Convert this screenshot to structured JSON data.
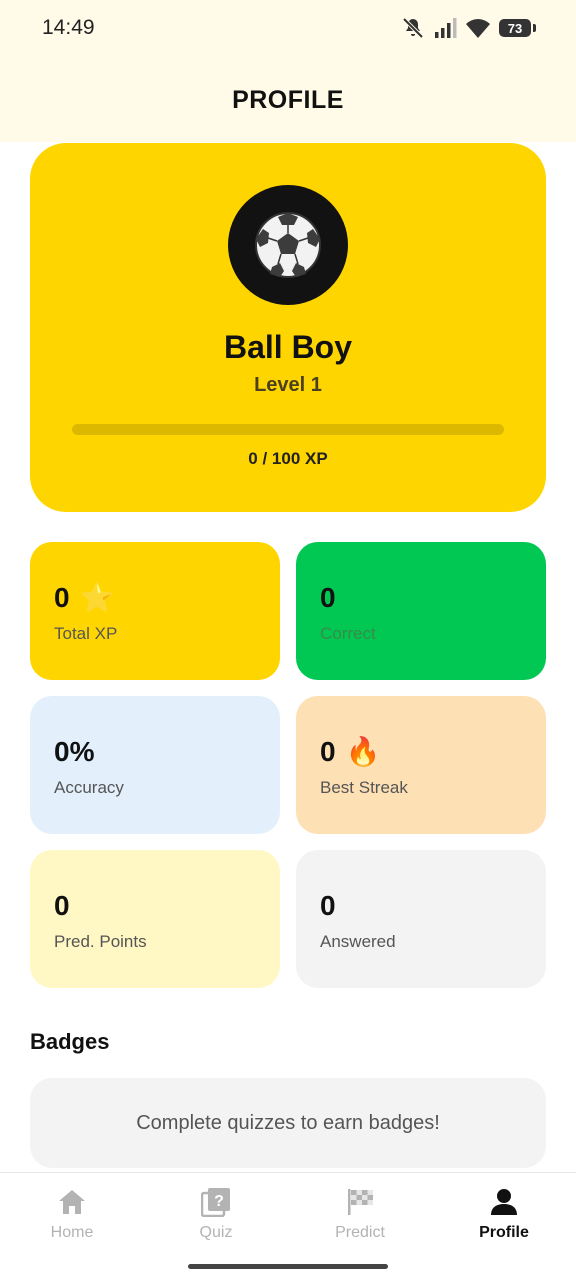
{
  "status_bar": {
    "time": "14:49",
    "battery": "73"
  },
  "header": {
    "title": "PROFILE"
  },
  "profile": {
    "avatar_icon": "soccer-ball-icon",
    "name": "Ball Boy",
    "level": "Level 1",
    "xp_text": "0 / 100 XP",
    "xp_progress": 0
  },
  "stats": [
    {
      "value": "0",
      "emoji": "⭐",
      "label": "Total XP",
      "bg": "#ffd500",
      "label_color": "#555"
    },
    {
      "value": "0",
      "emoji": "",
      "label": "Correct",
      "bg": "#00c853",
      "label_color": "#3b8a4a"
    },
    {
      "value": "0%",
      "emoji": "",
      "label": "Accuracy",
      "bg": "#e3f0fb",
      "label_color": "#555"
    },
    {
      "value": "0",
      "emoji": "🔥",
      "label": "Best Streak",
      "bg": "#fde0b4",
      "label_color": "#555"
    },
    {
      "value": "0",
      "emoji": "",
      "label": "Pred. Points",
      "bg": "#fff8c4",
      "label_color": "#555"
    },
    {
      "value": "0",
      "emoji": "",
      "label": "Answered",
      "bg": "#f3f3f3",
      "label_color": "#555"
    }
  ],
  "badges": {
    "title": "Badges",
    "empty_message": "Complete quizzes to earn badges!"
  },
  "nav": {
    "items": [
      {
        "label": "Home",
        "icon": "home-icon",
        "active": false
      },
      {
        "label": "Quiz",
        "icon": "quiz-icon",
        "active": false
      },
      {
        "label": "Predict",
        "icon": "checkered-flag-icon",
        "active": false
      },
      {
        "label": "Profile",
        "icon": "person-icon",
        "active": true
      }
    ]
  }
}
